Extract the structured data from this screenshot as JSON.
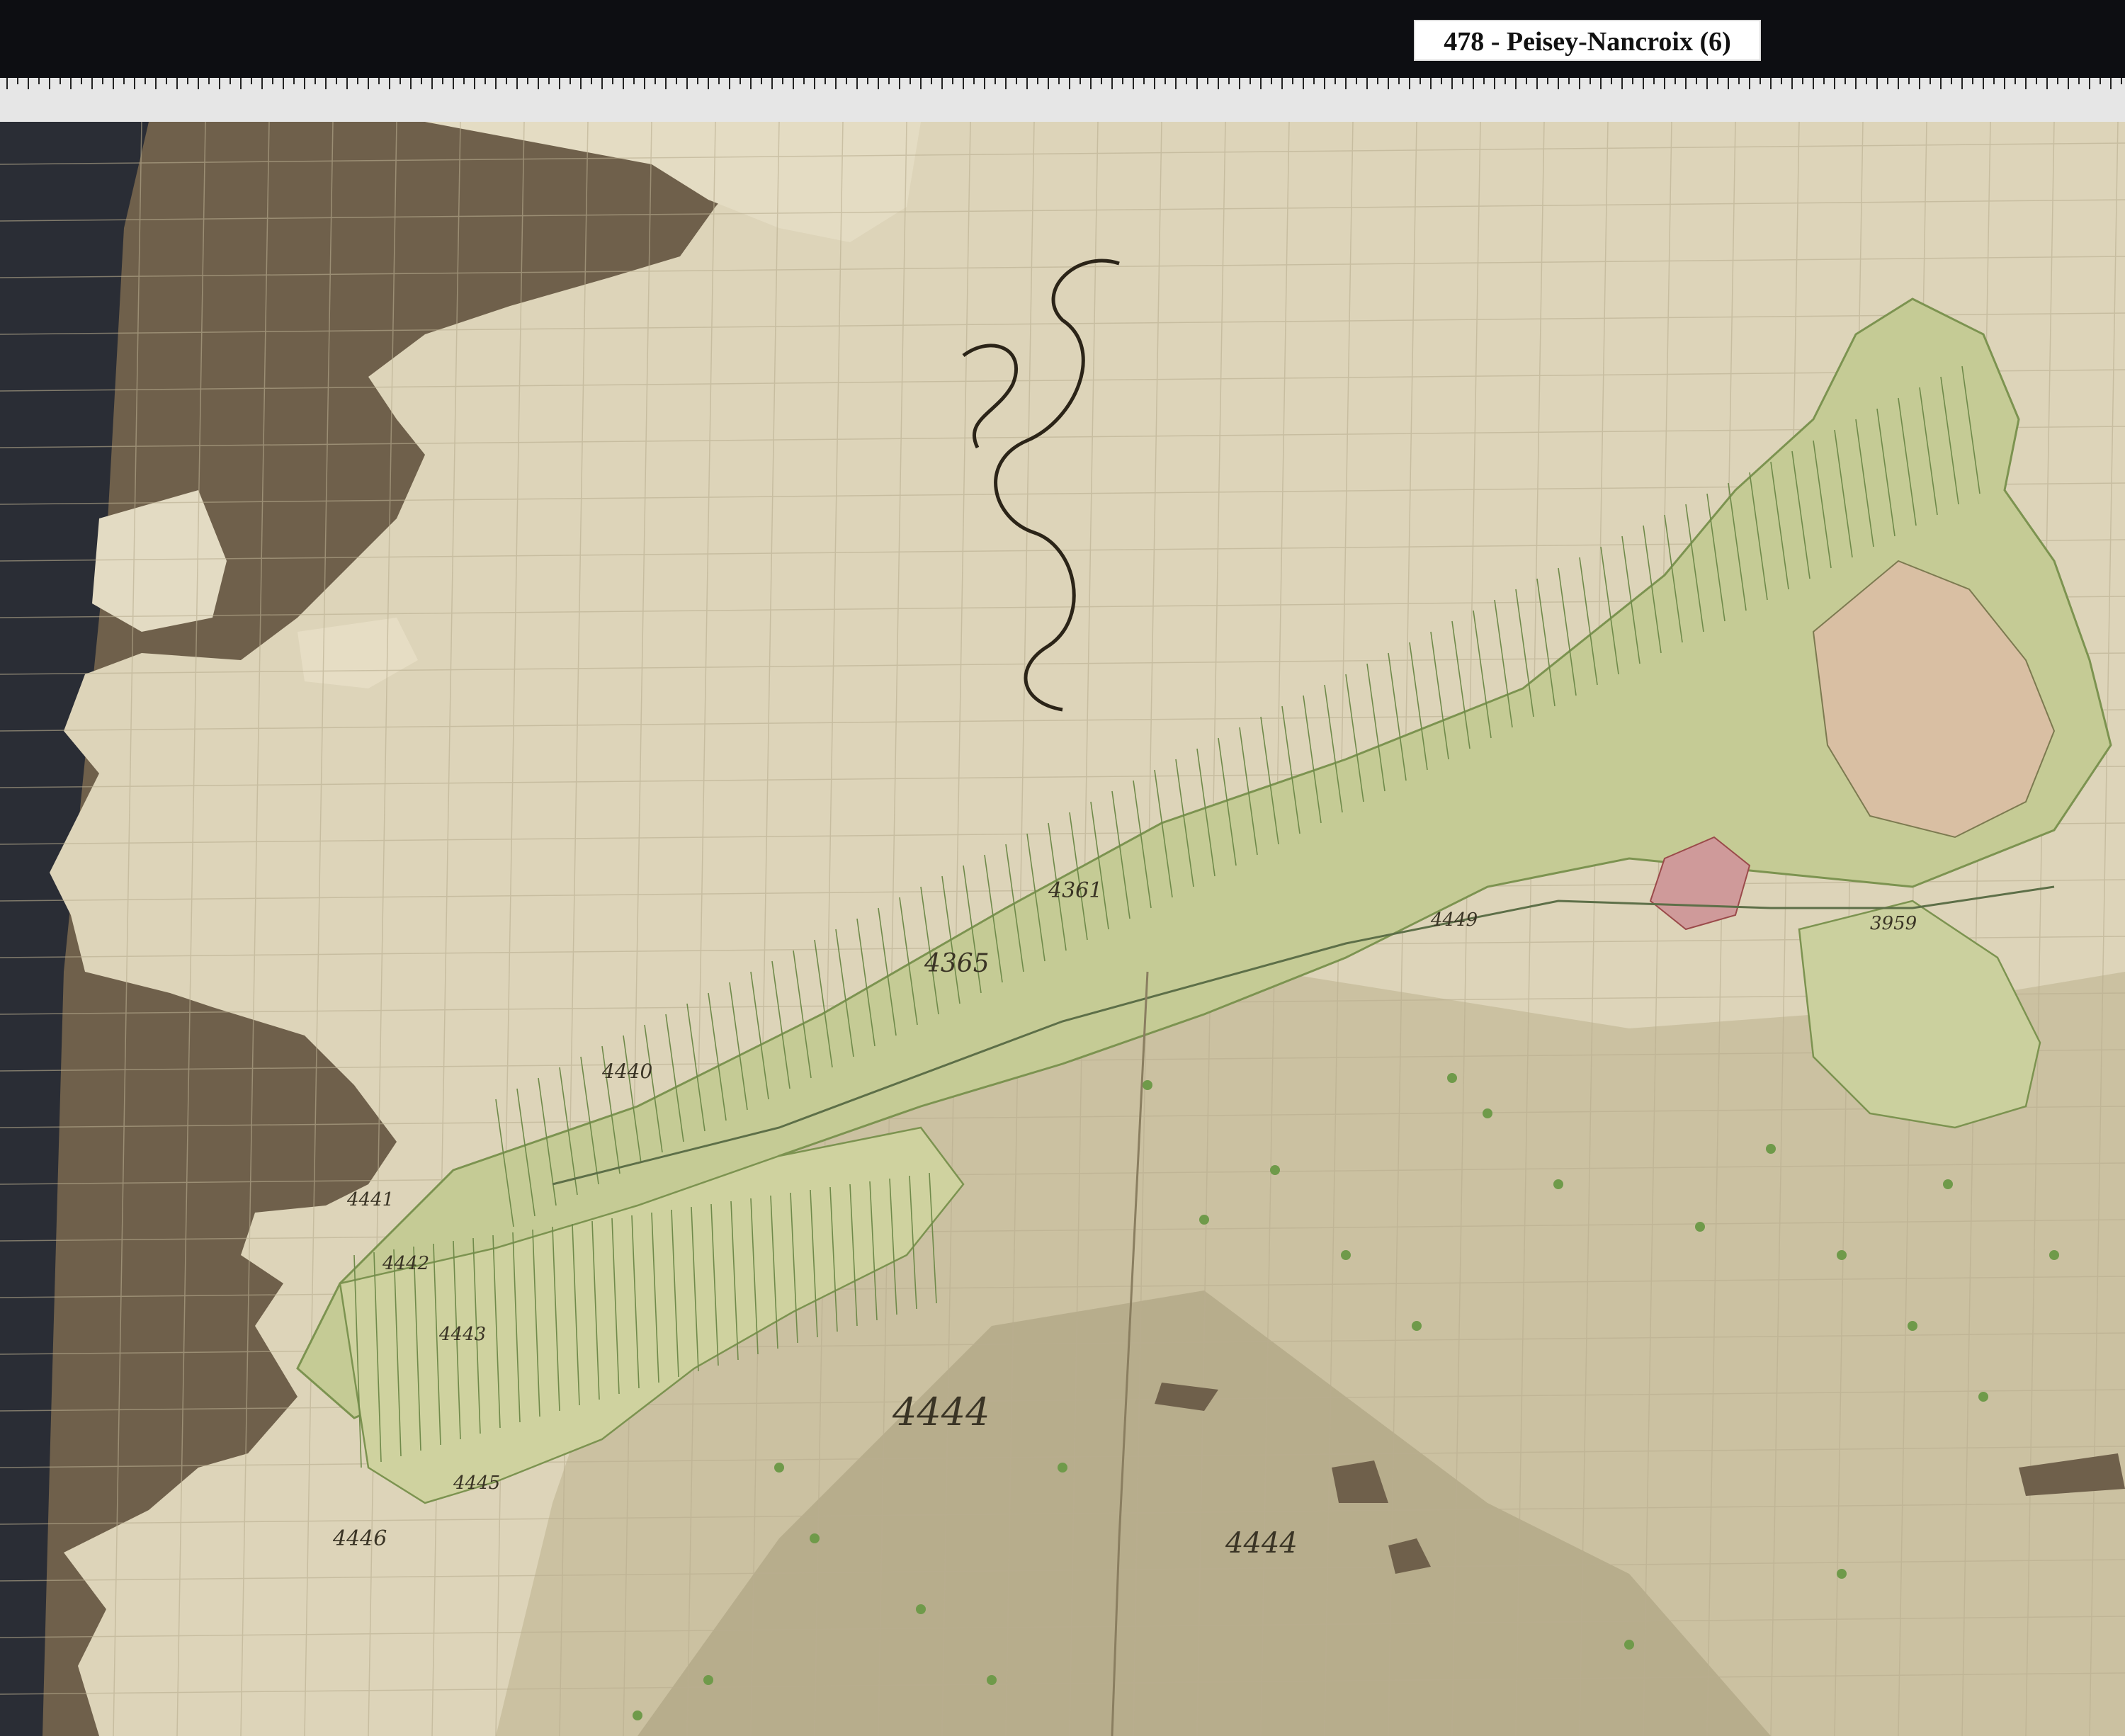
{
  "header": {
    "title": "478 - Peisey-Nancroix (6)"
  },
  "map": {
    "parcel_labels": {
      "meadow_mid": "4365",
      "meadow_left": "4361",
      "strip": "4449",
      "lower_left": "4440",
      "large_area": "4444",
      "far_left_a": "4446",
      "far_left_b": "4441",
      "far_left_c": "4442",
      "far_left_d": "4443",
      "far_left_e": "4445",
      "right_group": "3959",
      "center_mountain": "4444"
    },
    "colors": {
      "paper": "#e2dac2",
      "burlap": "#6f604b",
      "parcel_green": "#c9cf9a",
      "parcel_line": "#6f8a4a",
      "village_red": "#c98a8a",
      "ink": "#2b2418"
    }
  }
}
